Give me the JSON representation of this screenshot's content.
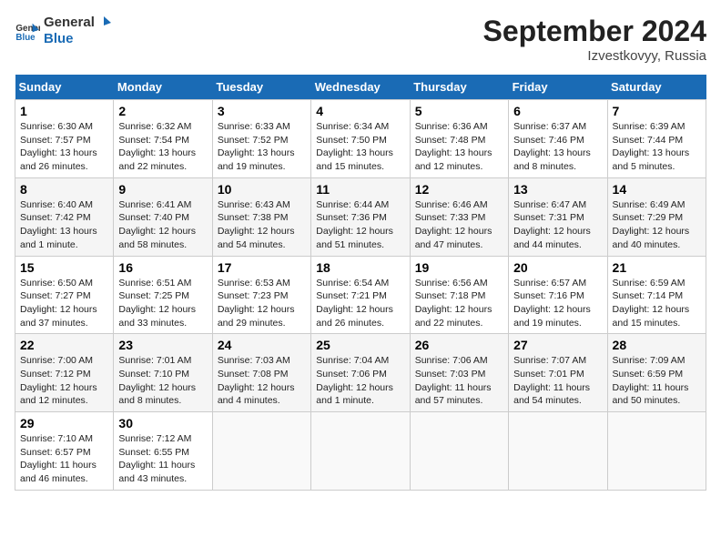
{
  "header": {
    "logo_general": "General",
    "logo_blue": "Blue",
    "month": "September 2024",
    "location": "Izvestkovyy, Russia"
  },
  "weekdays": [
    "Sunday",
    "Monday",
    "Tuesday",
    "Wednesday",
    "Thursday",
    "Friday",
    "Saturday"
  ],
  "weeks": [
    [
      {
        "day": "1",
        "info": "Sunrise: 6:30 AM\nSunset: 7:57 PM\nDaylight: 13 hours\nand 26 minutes."
      },
      {
        "day": "2",
        "info": "Sunrise: 6:32 AM\nSunset: 7:54 PM\nDaylight: 13 hours\nand 22 minutes."
      },
      {
        "day": "3",
        "info": "Sunrise: 6:33 AM\nSunset: 7:52 PM\nDaylight: 13 hours\nand 19 minutes."
      },
      {
        "day": "4",
        "info": "Sunrise: 6:34 AM\nSunset: 7:50 PM\nDaylight: 13 hours\nand 15 minutes."
      },
      {
        "day": "5",
        "info": "Sunrise: 6:36 AM\nSunset: 7:48 PM\nDaylight: 13 hours\nand 12 minutes."
      },
      {
        "day": "6",
        "info": "Sunrise: 6:37 AM\nSunset: 7:46 PM\nDaylight: 13 hours\nand 8 minutes."
      },
      {
        "day": "7",
        "info": "Sunrise: 6:39 AM\nSunset: 7:44 PM\nDaylight: 13 hours\nand 5 minutes."
      }
    ],
    [
      {
        "day": "8",
        "info": "Sunrise: 6:40 AM\nSunset: 7:42 PM\nDaylight: 13 hours\nand 1 minute."
      },
      {
        "day": "9",
        "info": "Sunrise: 6:41 AM\nSunset: 7:40 PM\nDaylight: 12 hours\nand 58 minutes."
      },
      {
        "day": "10",
        "info": "Sunrise: 6:43 AM\nSunset: 7:38 PM\nDaylight: 12 hours\nand 54 minutes."
      },
      {
        "day": "11",
        "info": "Sunrise: 6:44 AM\nSunset: 7:36 PM\nDaylight: 12 hours\nand 51 minutes."
      },
      {
        "day": "12",
        "info": "Sunrise: 6:46 AM\nSunset: 7:33 PM\nDaylight: 12 hours\nand 47 minutes."
      },
      {
        "day": "13",
        "info": "Sunrise: 6:47 AM\nSunset: 7:31 PM\nDaylight: 12 hours\nand 44 minutes."
      },
      {
        "day": "14",
        "info": "Sunrise: 6:49 AM\nSunset: 7:29 PM\nDaylight: 12 hours\nand 40 minutes."
      }
    ],
    [
      {
        "day": "15",
        "info": "Sunrise: 6:50 AM\nSunset: 7:27 PM\nDaylight: 12 hours\nand 37 minutes."
      },
      {
        "day": "16",
        "info": "Sunrise: 6:51 AM\nSunset: 7:25 PM\nDaylight: 12 hours\nand 33 minutes."
      },
      {
        "day": "17",
        "info": "Sunrise: 6:53 AM\nSunset: 7:23 PM\nDaylight: 12 hours\nand 29 minutes."
      },
      {
        "day": "18",
        "info": "Sunrise: 6:54 AM\nSunset: 7:21 PM\nDaylight: 12 hours\nand 26 minutes."
      },
      {
        "day": "19",
        "info": "Sunrise: 6:56 AM\nSunset: 7:18 PM\nDaylight: 12 hours\nand 22 minutes."
      },
      {
        "day": "20",
        "info": "Sunrise: 6:57 AM\nSunset: 7:16 PM\nDaylight: 12 hours\nand 19 minutes."
      },
      {
        "day": "21",
        "info": "Sunrise: 6:59 AM\nSunset: 7:14 PM\nDaylight: 12 hours\nand 15 minutes."
      }
    ],
    [
      {
        "day": "22",
        "info": "Sunrise: 7:00 AM\nSunset: 7:12 PM\nDaylight: 12 hours\nand 12 minutes."
      },
      {
        "day": "23",
        "info": "Sunrise: 7:01 AM\nSunset: 7:10 PM\nDaylight: 12 hours\nand 8 minutes."
      },
      {
        "day": "24",
        "info": "Sunrise: 7:03 AM\nSunset: 7:08 PM\nDaylight: 12 hours\nand 4 minutes."
      },
      {
        "day": "25",
        "info": "Sunrise: 7:04 AM\nSunset: 7:06 PM\nDaylight: 12 hours\nand 1 minute."
      },
      {
        "day": "26",
        "info": "Sunrise: 7:06 AM\nSunset: 7:03 PM\nDaylight: 11 hours\nand 57 minutes."
      },
      {
        "day": "27",
        "info": "Sunrise: 7:07 AM\nSunset: 7:01 PM\nDaylight: 11 hours\nand 54 minutes."
      },
      {
        "day": "28",
        "info": "Sunrise: 7:09 AM\nSunset: 6:59 PM\nDaylight: 11 hours\nand 50 minutes."
      }
    ],
    [
      {
        "day": "29",
        "info": "Sunrise: 7:10 AM\nSunset: 6:57 PM\nDaylight: 11 hours\nand 46 minutes."
      },
      {
        "day": "30",
        "info": "Sunrise: 7:12 AM\nSunset: 6:55 PM\nDaylight: 11 hours\nand 43 minutes."
      },
      {
        "day": "",
        "info": ""
      },
      {
        "day": "",
        "info": ""
      },
      {
        "day": "",
        "info": ""
      },
      {
        "day": "",
        "info": ""
      },
      {
        "day": "",
        "info": ""
      }
    ]
  ]
}
